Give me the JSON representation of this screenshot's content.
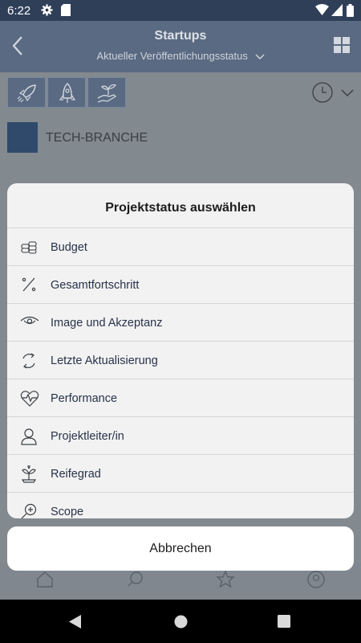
{
  "status_bar": {
    "time": "6:22"
  },
  "header": {
    "title": "Startups",
    "subtitle": "Aktueller Veröffentlichungsstatus"
  },
  "content": {
    "category": "TECH-BRANCHE"
  },
  "sheet": {
    "title": "Projektstatus auswählen",
    "items": [
      {
        "label": "Budget",
        "icon": "coins-icon"
      },
      {
        "label": "Gesamtfortschritt",
        "icon": "percent-icon"
      },
      {
        "label": "Image und Akzeptanz",
        "icon": "eye-icon"
      },
      {
        "label": "Letzte Aktualisierung",
        "icon": "refresh-icon"
      },
      {
        "label": "Performance",
        "icon": "heart-pulse-icon"
      },
      {
        "label": "Projektleiter/in",
        "icon": "person-icon"
      },
      {
        "label": "Reifegrad",
        "icon": "plant-icon"
      },
      {
        "label": "Scope",
        "icon": "zoom-in-icon"
      }
    ]
  },
  "cancel_label": "Abbrechen",
  "colors": {
    "header": "#2f3f58",
    "accent": "#2f4a6b",
    "sheet": "#f2f2f2"
  }
}
